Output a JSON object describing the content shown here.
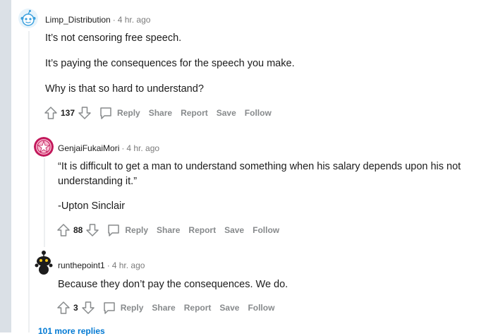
{
  "comments": [
    {
      "author": "Limp_Distribution",
      "time": "4 hr. ago",
      "paragraphs": [
        "It’s not censoring free speech.",
        "It’s paying the consequences for the speech you make.",
        "Why is that so hard to understand?"
      ],
      "score": "137",
      "reply_label": "Reply",
      "share_label": "Share",
      "report_label": "Report",
      "save_label": "Save",
      "follow_label": "Follow"
    },
    {
      "author": "GenjaiFukaiMori",
      "time": "4 hr. ago",
      "paragraphs": [
        "“It is difficult to get a man to understand something when his salary depends upon his not understanding it.”",
        "-Upton Sinclair"
      ],
      "score": "88",
      "reply_label": "Reply",
      "share_label": "Share",
      "report_label": "Report",
      "save_label": "Save",
      "follow_label": "Follow"
    },
    {
      "author": "runthepoint1",
      "time": "4 hr. ago",
      "paragraphs": [
        "Because they don’t pay the consequences. We do."
      ],
      "score": "3",
      "reply_label": "Reply",
      "share_label": "Share",
      "report_label": "Report",
      "save_label": "Save",
      "follow_label": "Follow"
    }
  ],
  "more_replies_label": "101 more replies",
  "colors": {
    "meta": "#7c7c7c",
    "action": "#878a8c",
    "rail": "#dae0e6",
    "link": "#0079d3"
  }
}
